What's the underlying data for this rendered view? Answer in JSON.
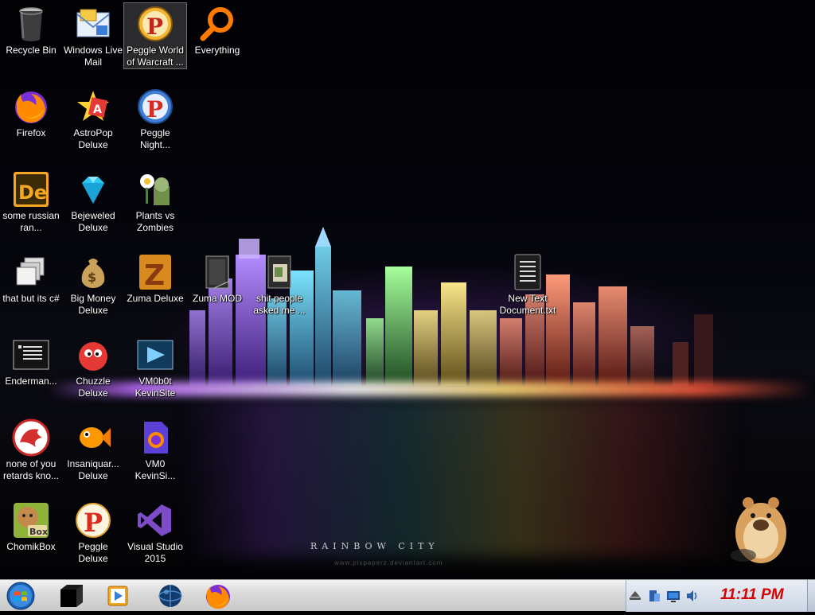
{
  "desktop": {
    "wallpaper_title": "RAINBOW CITY",
    "wallpaper_url": "www.pixpaperz.deviantart.com",
    "icons": [
      {
        "label": "Recycle Bin"
      },
      {
        "label": "Windows Live Mail"
      },
      {
        "label": "Peggle World of Warcraft ..."
      },
      {
        "label": "Everything"
      },
      {
        "label": "Firefox"
      },
      {
        "label": "AstroPop Deluxe"
      },
      {
        "label": "Peggle Night..."
      },
      {
        "label": "some russian ran..."
      },
      {
        "label": "Bejeweled Deluxe"
      },
      {
        "label": "Plants vs Zombies"
      },
      {
        "label": "that but its c#"
      },
      {
        "label": "Big Money Deluxe"
      },
      {
        "label": "Zuma Deluxe"
      },
      {
        "label": "Zuma MOD"
      },
      {
        "label": "shit people asked me ..."
      },
      {
        "label": "New Text Document.txt"
      },
      {
        "label": "Enderman..."
      },
      {
        "label": "Chuzzle Deluxe"
      },
      {
        "label": "VM0b0t KevinSite"
      },
      {
        "label": "none of you retards kno..."
      },
      {
        "label": "Insaniquar... Deluxe"
      },
      {
        "label": "VM0 KevinSi..."
      },
      {
        "label": "ChomikBox"
      },
      {
        "label": "Peggle Deluxe"
      },
      {
        "label": "Visual Studio 2015"
      }
    ]
  },
  "taskbar": {
    "clock": "11:11 PM",
    "pinned": [
      {
        "name": "terminal-box"
      },
      {
        "name": "media-player"
      },
      {
        "name": "globe"
      },
      {
        "name": "firefox"
      }
    ]
  },
  "colors": {
    "clock": "#d50000",
    "taskbar": "#d9d9d9",
    "desktop": "#05050c"
  }
}
